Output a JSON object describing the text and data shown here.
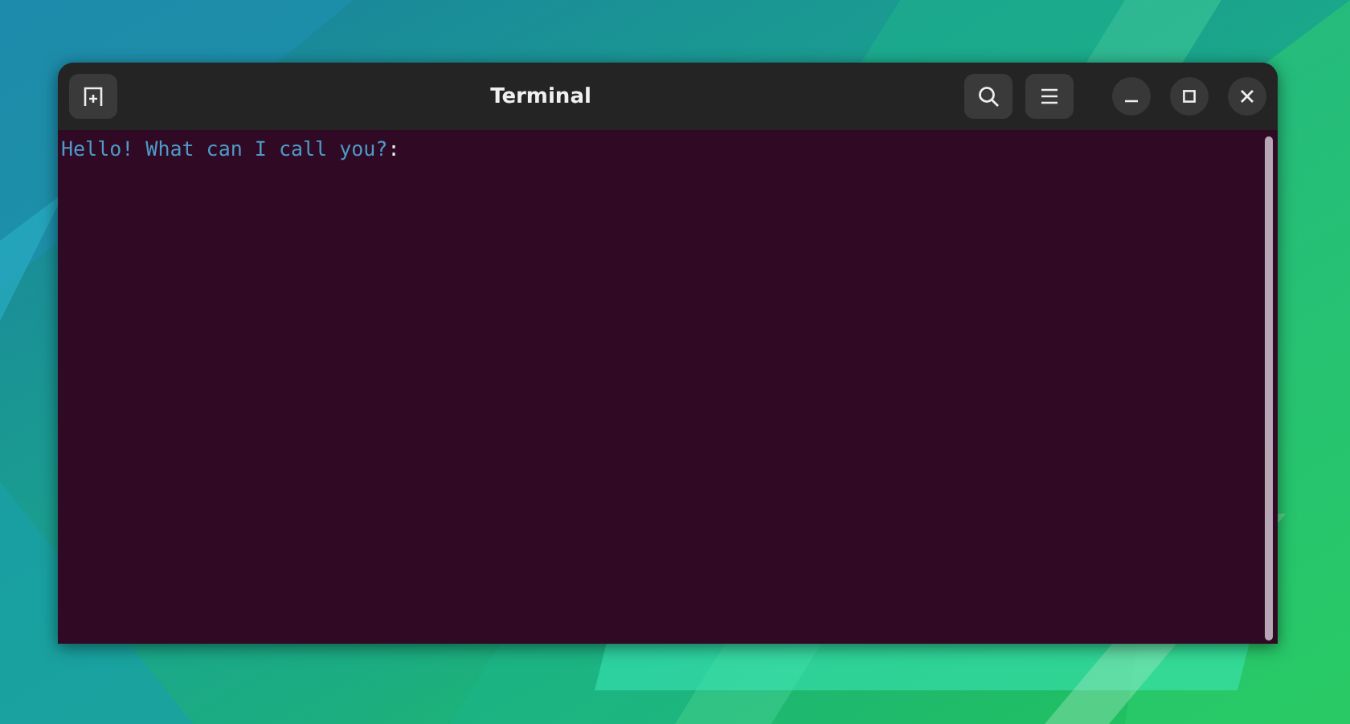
{
  "window": {
    "title": "Terminal",
    "header_start": [
      {
        "kind": "new-tab"
      }
    ],
    "header_end": [
      {
        "kind": "search"
      },
      {
        "kind": "menu"
      }
    ],
    "window_controls": [
      {
        "kind": "minimize"
      },
      {
        "kind": "maximize"
      },
      {
        "kind": "close"
      }
    ],
    "terminal": {
      "lines": [
        {
          "segments": [
            {
              "text": "Hello! What can I call you?",
              "kind": "prompt"
            },
            {
              "text": ":",
              "kind": "plain"
            }
          ]
        }
      ]
    }
  }
}
